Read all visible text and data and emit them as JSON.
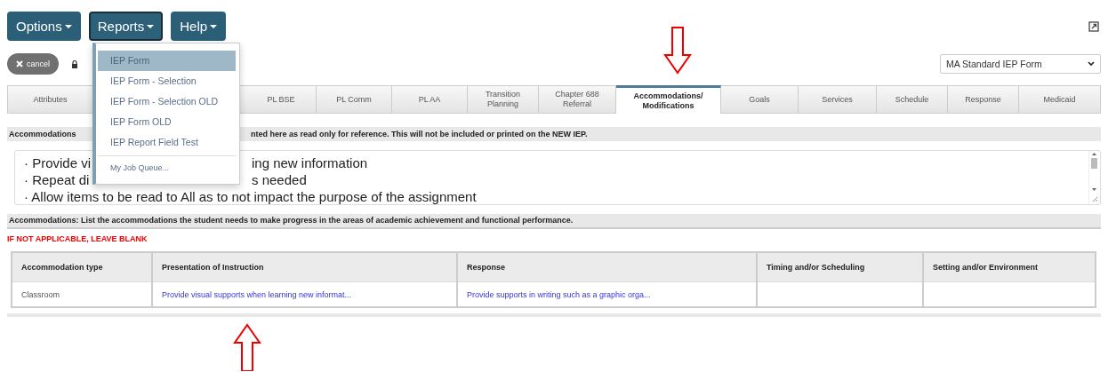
{
  "menubar": [
    {
      "label": "Options",
      "selected": false
    },
    {
      "label": "Reports",
      "selected": true
    },
    {
      "label": "Help",
      "selected": false
    }
  ],
  "reports_menu": {
    "items": [
      {
        "label": "IEP Form",
        "selected": true
      },
      {
        "label": "IEP Form - Selection",
        "selected": false
      },
      {
        "label": "IEP Form - Selection OLD",
        "selected": false
      },
      {
        "label": "IEP Form OLD",
        "selected": false
      },
      {
        "label": "IEP Report Field Test",
        "selected": false
      },
      {
        "label": "My Job Queue...",
        "selected": false,
        "kind": "separated"
      }
    ]
  },
  "cancel_button": "cancel",
  "form_select": {
    "value": "MA Standard IEP Form"
  },
  "tabs": [
    {
      "label": "Attributes",
      "selected": false
    },
    {
      "label": "PL BSE",
      "selected": false
    },
    {
      "label": "PL Comm",
      "selected": false
    },
    {
      "label": "PL AA",
      "selected": false
    },
    {
      "label": "Transition Planning",
      "selected": false
    },
    {
      "label": "Chapter 688 Referral",
      "selected": false
    },
    {
      "label": "Accommodations/ Modifications",
      "selected": true
    },
    {
      "label": "Goals",
      "selected": false
    },
    {
      "label": "Services",
      "selected": false
    },
    {
      "label": "Schedule",
      "selected": false
    },
    {
      "label": "Response",
      "selected": false
    },
    {
      "label": "Medicaid",
      "selected": false
    }
  ],
  "reference_bar": {
    "parts": [
      "Accommodations",
      "nted here as read only for reference.  This will not be included or printed on the NEW IEP."
    ]
  },
  "reference_text": {
    "lines": [
      {
        "parts": [
          "· Provide vi",
          "ing new information"
        ]
      },
      {
        "parts": [
          "· Repeat di",
          "s needed"
        ]
      },
      {
        "parts": [
          "· Allow items to be read to All as to not impact the purpose of the assignment"
        ]
      }
    ]
  },
  "instructions": "Accommodations: List the accommodations the student needs to make progress in the areas of academic achievement and functional performance.",
  "warning": "IF NOT APPLICABLE, LEAVE BLANK",
  "table": {
    "columns": [
      "Accommodation type",
      "Presentation of Instruction",
      "Response",
      "Timing and/or Scheduling",
      "Setting and/or Environment"
    ],
    "rows": [
      {
        "cells": [
          {
            "text": "Classroom",
            "kind": "text"
          },
          {
            "text": "Provide visual supports when learning new informat...",
            "kind": "link"
          },
          {
            "text": "Provide supports in writing such as a graphic orga...",
            "kind": "link"
          },
          {
            "kind": "empty"
          },
          {
            "kind": "empty"
          }
        ]
      }
    ]
  }
}
